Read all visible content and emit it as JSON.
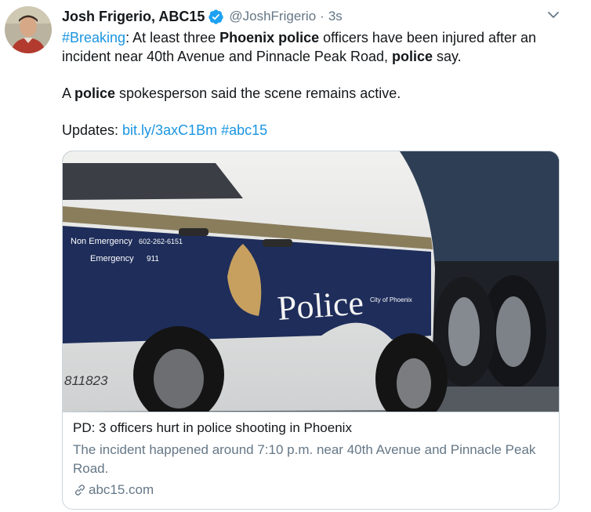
{
  "author": {
    "name": "Josh Frigerio, ABC15",
    "handle": "@JoshFrigerio",
    "separator": "·",
    "time": "3s"
  },
  "tweet": {
    "line1": {
      "hashtag": "#Breaking",
      "t1": ": At least three ",
      "b1": "Phoenix police",
      "t2": " officers have been injured after an incident near 40th Avenue and Pinnacle Peak Road, ",
      "b2": "police",
      "t3": " say."
    },
    "line2": {
      "t1": "A ",
      "b1": "police",
      "t2": " spokesperson said the scene remains active."
    },
    "line3": {
      "t1": "Updates: ",
      "url": "bit.ly/3axC1Bm",
      "space": " ",
      "hashtag": "#abc15"
    }
  },
  "card": {
    "title": "PD: 3 officers hurt in police shooting in Phoenix",
    "description": "The incident happened around 7:10 p.m. near 40th Avenue and Pinnacle Peak Road.",
    "domain": "abc15.com",
    "image_text": {
      "line1": "Non Emergency",
      "line2": "Emergency",
      "phone": "602-262-6151",
      "emergency_number": "911",
      "word": "Police",
      "city": "City of Phoenix",
      "unit_number": "811823"
    }
  },
  "colors": {
    "link": "#1b95e0",
    "secondary_text": "#657786",
    "border": "#ccd6dd",
    "verified": "#1da1f2"
  }
}
